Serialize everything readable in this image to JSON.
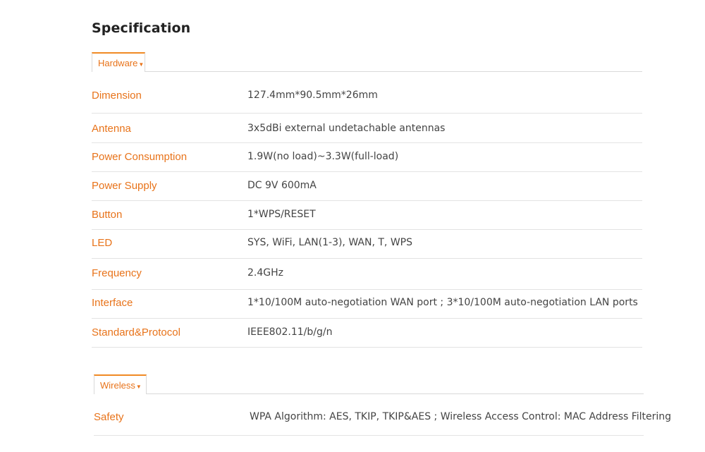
{
  "page_title": "Specification",
  "accent_color": "#e8731a",
  "hardware": {
    "tab_label": "Hardware",
    "tab_icon": "chevron-down-icon",
    "rows": [
      {
        "label": "Dimension",
        "value": "127.4mm*90.5mm*26mm"
      },
      {
        "label": "Antenna",
        "value": "3x5dBi external undetachable antennas"
      },
      {
        "label": "Power Consumption",
        "value": "1.9W(no load)~3.3W(full-load)"
      },
      {
        "label": "Power Supply",
        "value": "DC 9V 600mA"
      },
      {
        "label": "Button",
        "value": "1*WPS/RESET"
      },
      {
        "label": "LED",
        "value": "SYS, WiFi, LAN(1-3), WAN, T, WPS"
      },
      {
        "label": "Frequency",
        "value": "2.4GHz"
      },
      {
        "label": "Interface",
        "value": "1*10/100M auto-negotiation WAN port ; 3*10/100M auto-negotiation LAN ports"
      },
      {
        "label": "Standard&Protocol",
        "value": "IEEE802.11/b/g/n"
      }
    ]
  },
  "wireless": {
    "tab_label": "Wireless",
    "tab_icon": "chevron-down-icon",
    "rows": [
      {
        "label": "Safety",
        "value": "WPA Algorithm: AES, TKIP, TKIP&AES ; Wireless Access Control: MAC Address Filtering"
      }
    ]
  }
}
